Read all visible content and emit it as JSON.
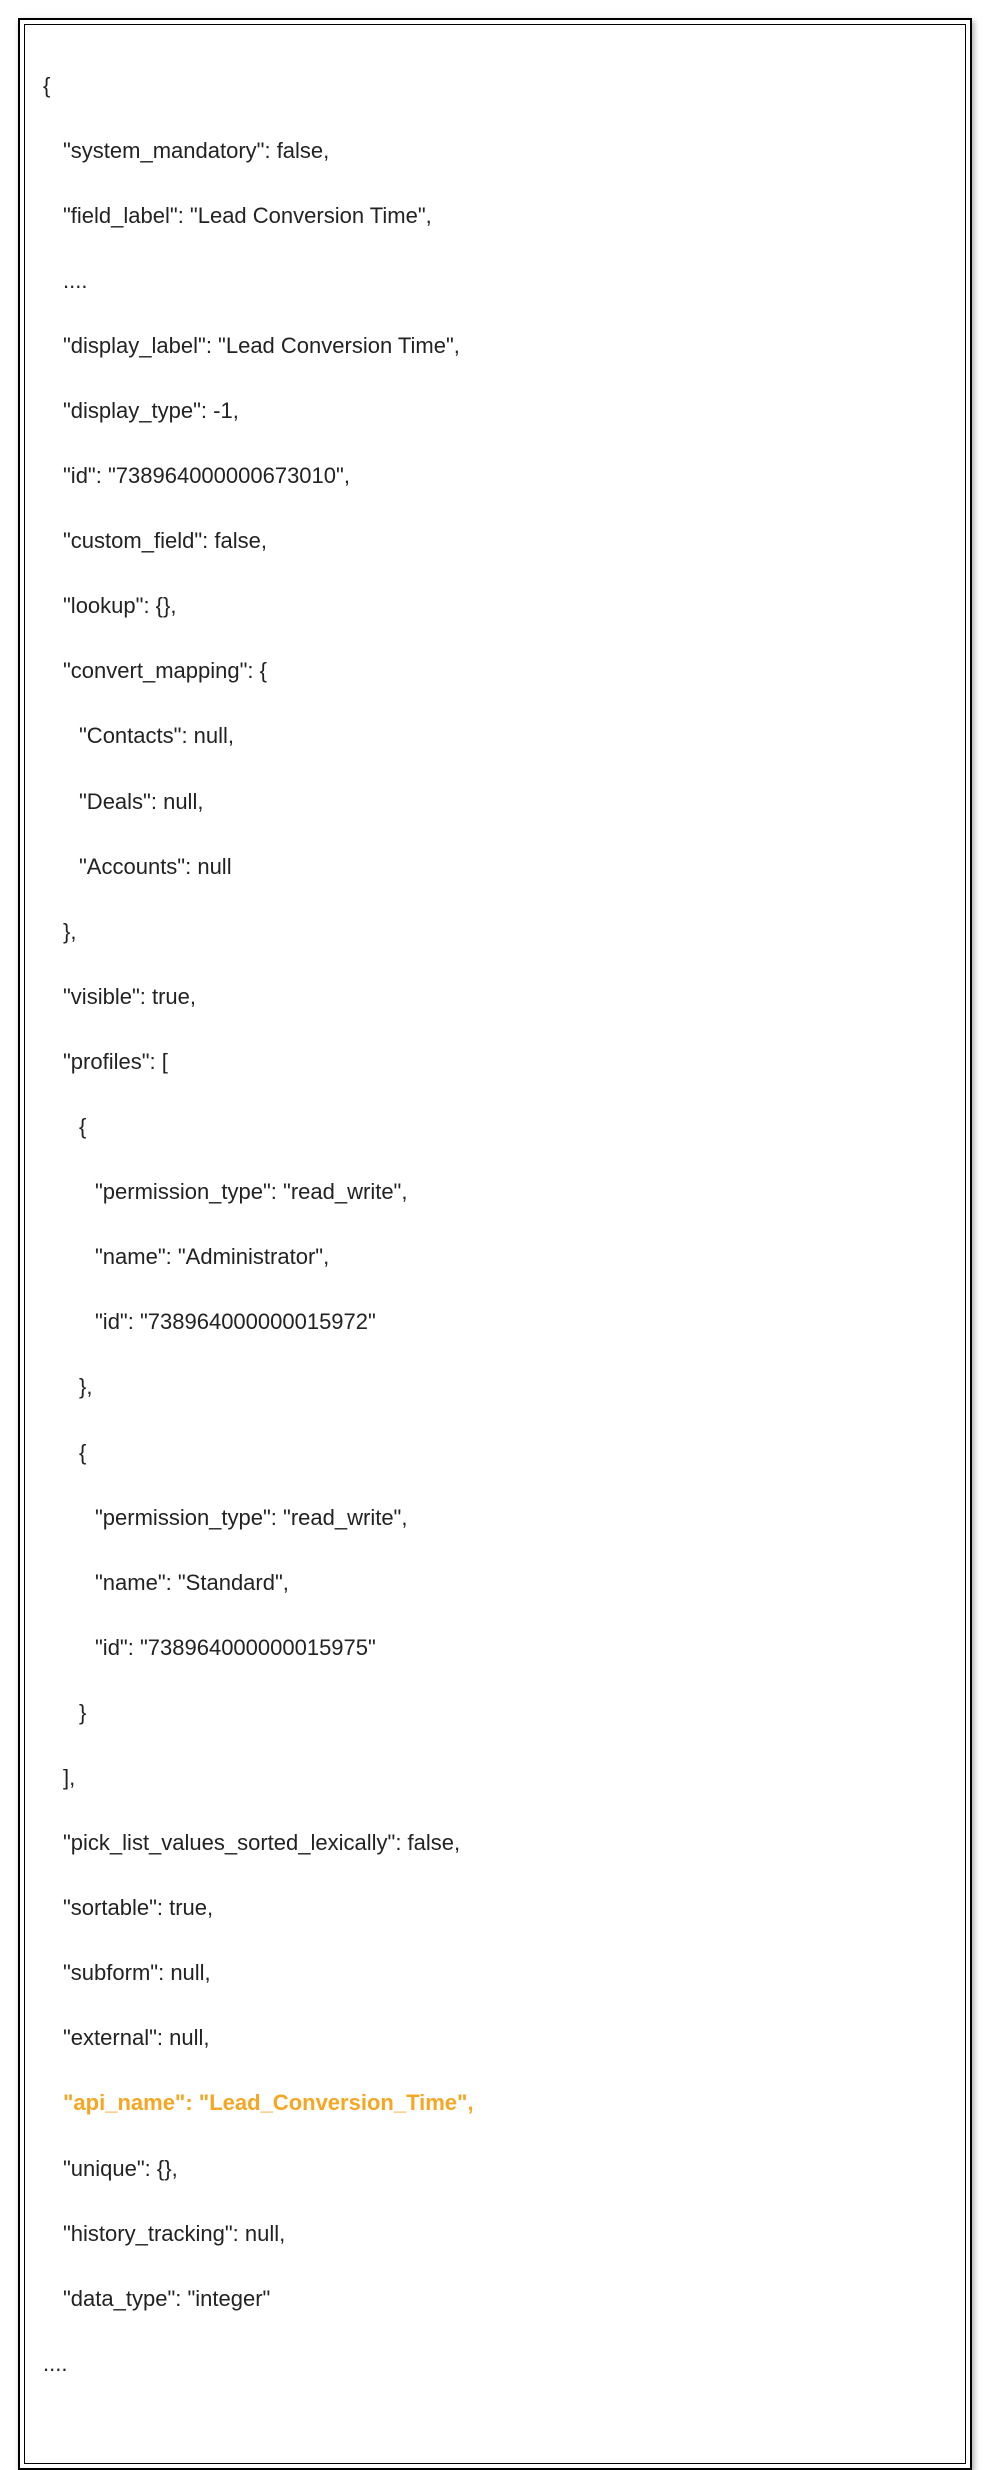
{
  "code": {
    "open_brace": "{",
    "ellipsis": "....",
    "close_obj": "},",
    "close_obj_no_comma": "}",
    "close_arr": "],",
    "l_system_mandatory": "\"system_mandatory\": false,",
    "l_field_label": "\"field_label\": \"Lead Conversion Time\",",
    "l_display_label": "\"display_label\": \"Lead Conversion Time\",",
    "l_display_type": "\"display_type\": -1,",
    "l_id": "\"id\": \"738964000000673010\",",
    "l_custom_field": "\"custom_field\": false,",
    "l_lookup": "\"lookup\": {},",
    "l_convert_mapping_open": "\"convert_mapping\": {",
    "l_contacts": "\"Contacts\": null,",
    "l_deals": "\"Deals\": null,",
    "l_accounts": "\"Accounts\": null",
    "l_visible": "\"visible\": true,",
    "l_profiles_open": "\"profiles\": [",
    "open_obj": "{",
    "l_perm_rw": "\"permission_type\": \"read_write\",",
    "l_name_admin": "\"name\": \"Administrator\",",
    "l_profile_id1": "\"id\": \"738964000000015972\"",
    "l_name_standard": "\"name\": \"Standard\",",
    "l_profile_id2": "\"id\": \"738964000000015975\"",
    "l_picklist": "\"pick_list_values_sorted_lexically\": false,",
    "l_sortable": "\"sortable\": true,",
    "l_subform": "\"subform\": null,",
    "l_external": "\"external\": null,",
    "l_api_name": "\"api_name\": \"Lead_Conversion_Time\",",
    "l_unique": "\"unique\": {},",
    "l_history": "\"history_tracking\": null,",
    "l_data_type": "\"data_type\": \"integer\"",
    "trailing_ellipsis": "...."
  },
  "highlight_color": "#f5a623"
}
